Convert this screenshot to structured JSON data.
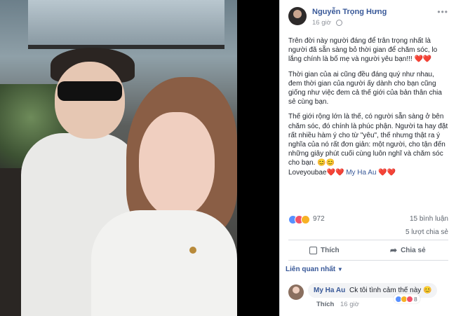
{
  "post": {
    "author": "Nguyễn Trọng Hưng",
    "time": "16 giờ",
    "paragraphs": [
      "Trên đời này người đáng để trân trọng nhất là người đã sẵn sàng bỏ thời gian để chăm sóc, lo lắng chính là bố mẹ và người yêu bạn!!!",
      "Thời gian của ai cũng đều đáng quý như nhau, đem thời gian của người ấy dành cho bạn cũng giống như việc đem cả thế giới của bản thân chia sẻ cùng bạn.",
      "Thế giới rộng lớn là thế, có người sẵn sàng ở bên chăm sóc, đó chính là phúc phận. Người ta hay đặt rất nhiều hàm ý cho từ \"yêu\", thế nhưng thật ra ý nghĩa của nó rất đơn giản: một người, cho tận đến những giây phút cuối cùng luôn nghĩ và chăm sóc cho bạn."
    ],
    "emoji_tail": "😊😊",
    "hearts_1": "❤️❤️",
    "signoff": "Loveyoubae",
    "hearts_2": "❤️❤️",
    "tagged": "My Ha Au",
    "hearts_3": "❤️❤️"
  },
  "stats": {
    "reaction_count": "972",
    "comments": "15 bình luận",
    "shares": "5 lượt chia sẻ"
  },
  "actions": {
    "like": "Thích",
    "share": "Chia sẻ"
  },
  "sort_label": "Liên quan nhất",
  "comment": {
    "author": "My Ha Au",
    "text": "Ck tôi tình cảm thế này 😊",
    "like": "Thích",
    "time": "16 giờ",
    "reaction_count": "8"
  },
  "colors": {
    "link": "#385898",
    "secondary_text": "#606770",
    "heart": "#e0245e"
  }
}
